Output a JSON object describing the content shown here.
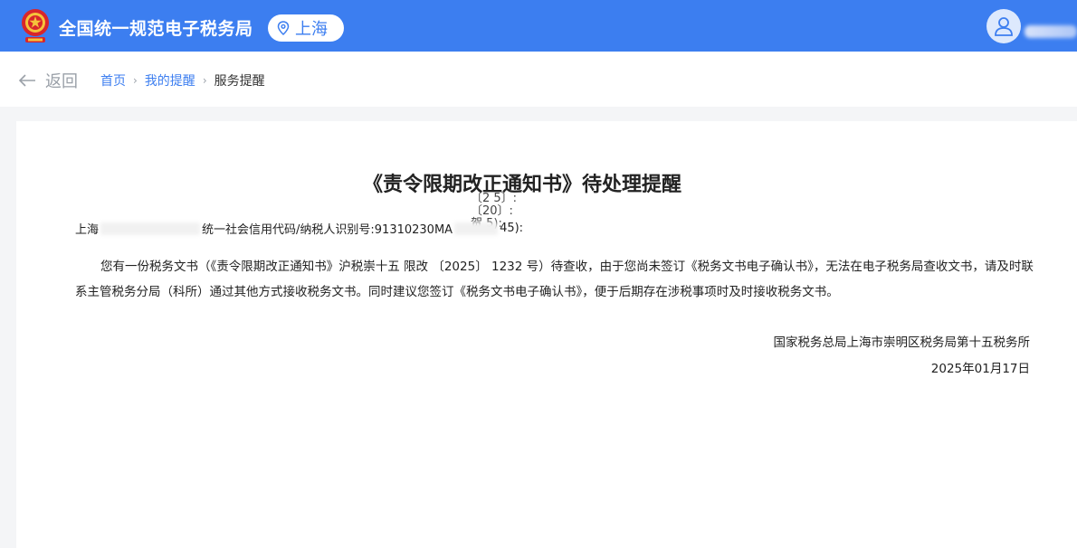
{
  "header": {
    "app_title": "全国统一规范电子税务局",
    "region": "上海",
    "icons": {
      "emblem": "national-emblem-icon",
      "pin": "location-pin-icon",
      "user": "user-icon"
    },
    "colors": {
      "header_bg": "#3c7ef0",
      "accent": "#3c7ef0"
    }
  },
  "nav": {
    "back_label": "返回",
    "breadcrumb": [
      "首页",
      "我的提醒",
      "服务提醒"
    ]
  },
  "notice": {
    "title": "《责令限期改正通知书》待处理提醒",
    "overlap_lines": [
      "〔2  5〕:",
      "〔20〕:   ",
      "贺    5):       "
    ],
    "salutation_prefix": "上海",
    "salutation_mid": "统一社会信用代码/纳税人识别号:91310230MA",
    "salutation_suffix": "45):",
    "body": "您有一份税务文书（《责令限期改正通知书》沪税崇十五 限改 〔2025〕 1232 号）待查收，由于您尚未签订《税务文书电子确认书》，无法在电子税务局查收文书，请及时联系主管税务分局（科所）通过其他方式接收税务文书。同时建议您签订《税务文书电子确认书》，便于后期存在涉税事项时及时接收税务文书。",
    "issuer": "国家税务总局上海市崇明区税务局第十五税务所",
    "date": "2025年01月17日"
  }
}
